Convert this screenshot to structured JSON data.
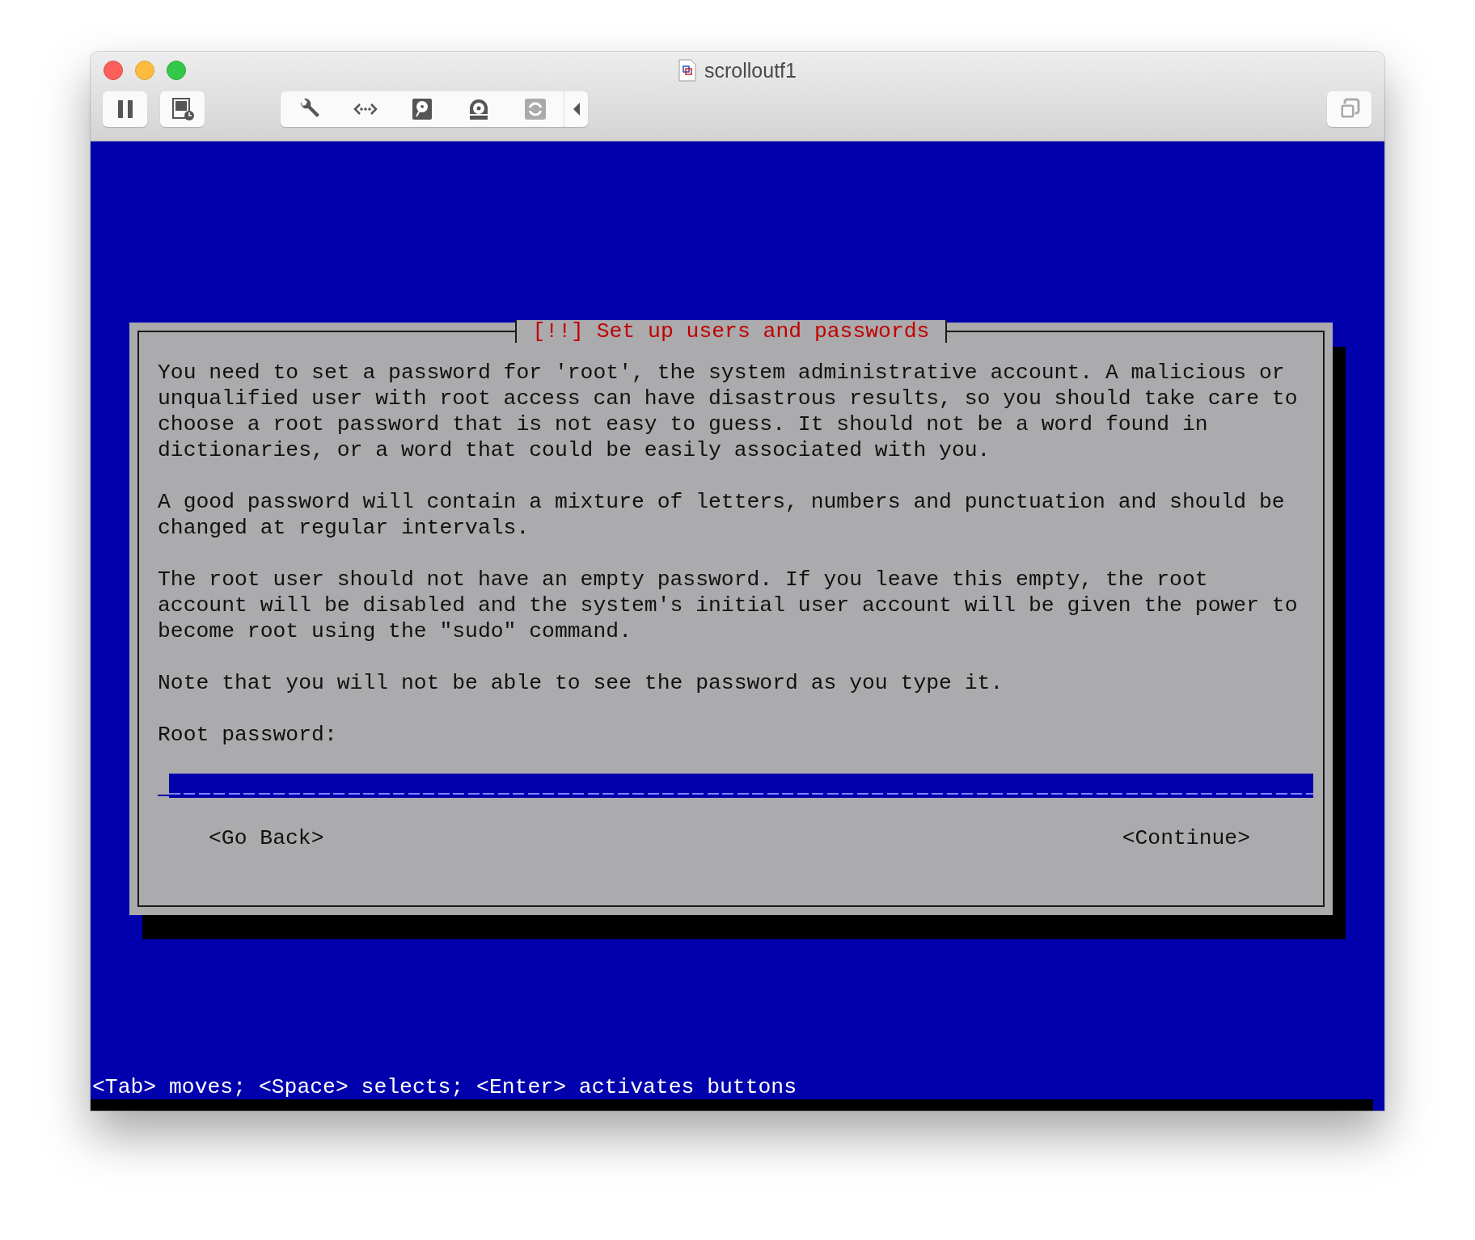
{
  "window": {
    "title": "scrolloutf1"
  },
  "toolbar": {
    "left": [
      {
        "kind": "pause"
      },
      {
        "kind": "snapshot"
      }
    ],
    "devices": [
      {
        "kind": "settings",
        "disabled": false
      },
      {
        "kind": "network",
        "disabled": false
      },
      {
        "kind": "disk",
        "disabled": false
      },
      {
        "kind": "optical",
        "disabled": false
      },
      {
        "kind": "sync",
        "disabled": true
      },
      {
        "kind": "collapse",
        "disabled": false
      }
    ],
    "right": [
      {
        "kind": "windows"
      }
    ]
  },
  "dialog": {
    "title": "[!!] Set up users and passwords",
    "paragraphs": [
      "You need to set a password for 'root', the system administrative account. A malicious or\nunqualified user with root access can have disastrous results, so you should take care to\nchoose a root password that is not easy to guess. It should not be a word found in\ndictionaries, or a word that could be easily associated with you.",
      "A good password will contain a mixture of letters, numbers and punctuation and should be\nchanged at regular intervals.",
      "The root user should not have an empty password. If you leave this empty, the root\naccount will be disabled and the system's initial user account will be given the power to\nbecome root using the \"sudo\" command.",
      "Note that you will not be able to see the password as you type it."
    ],
    "field_label": "Root password:",
    "buttons": [
      "<Go Back>",
      "<Continue>"
    ]
  },
  "status_bar": "<Tab> moves; <Space> selects; <Enter> activates buttons"
}
